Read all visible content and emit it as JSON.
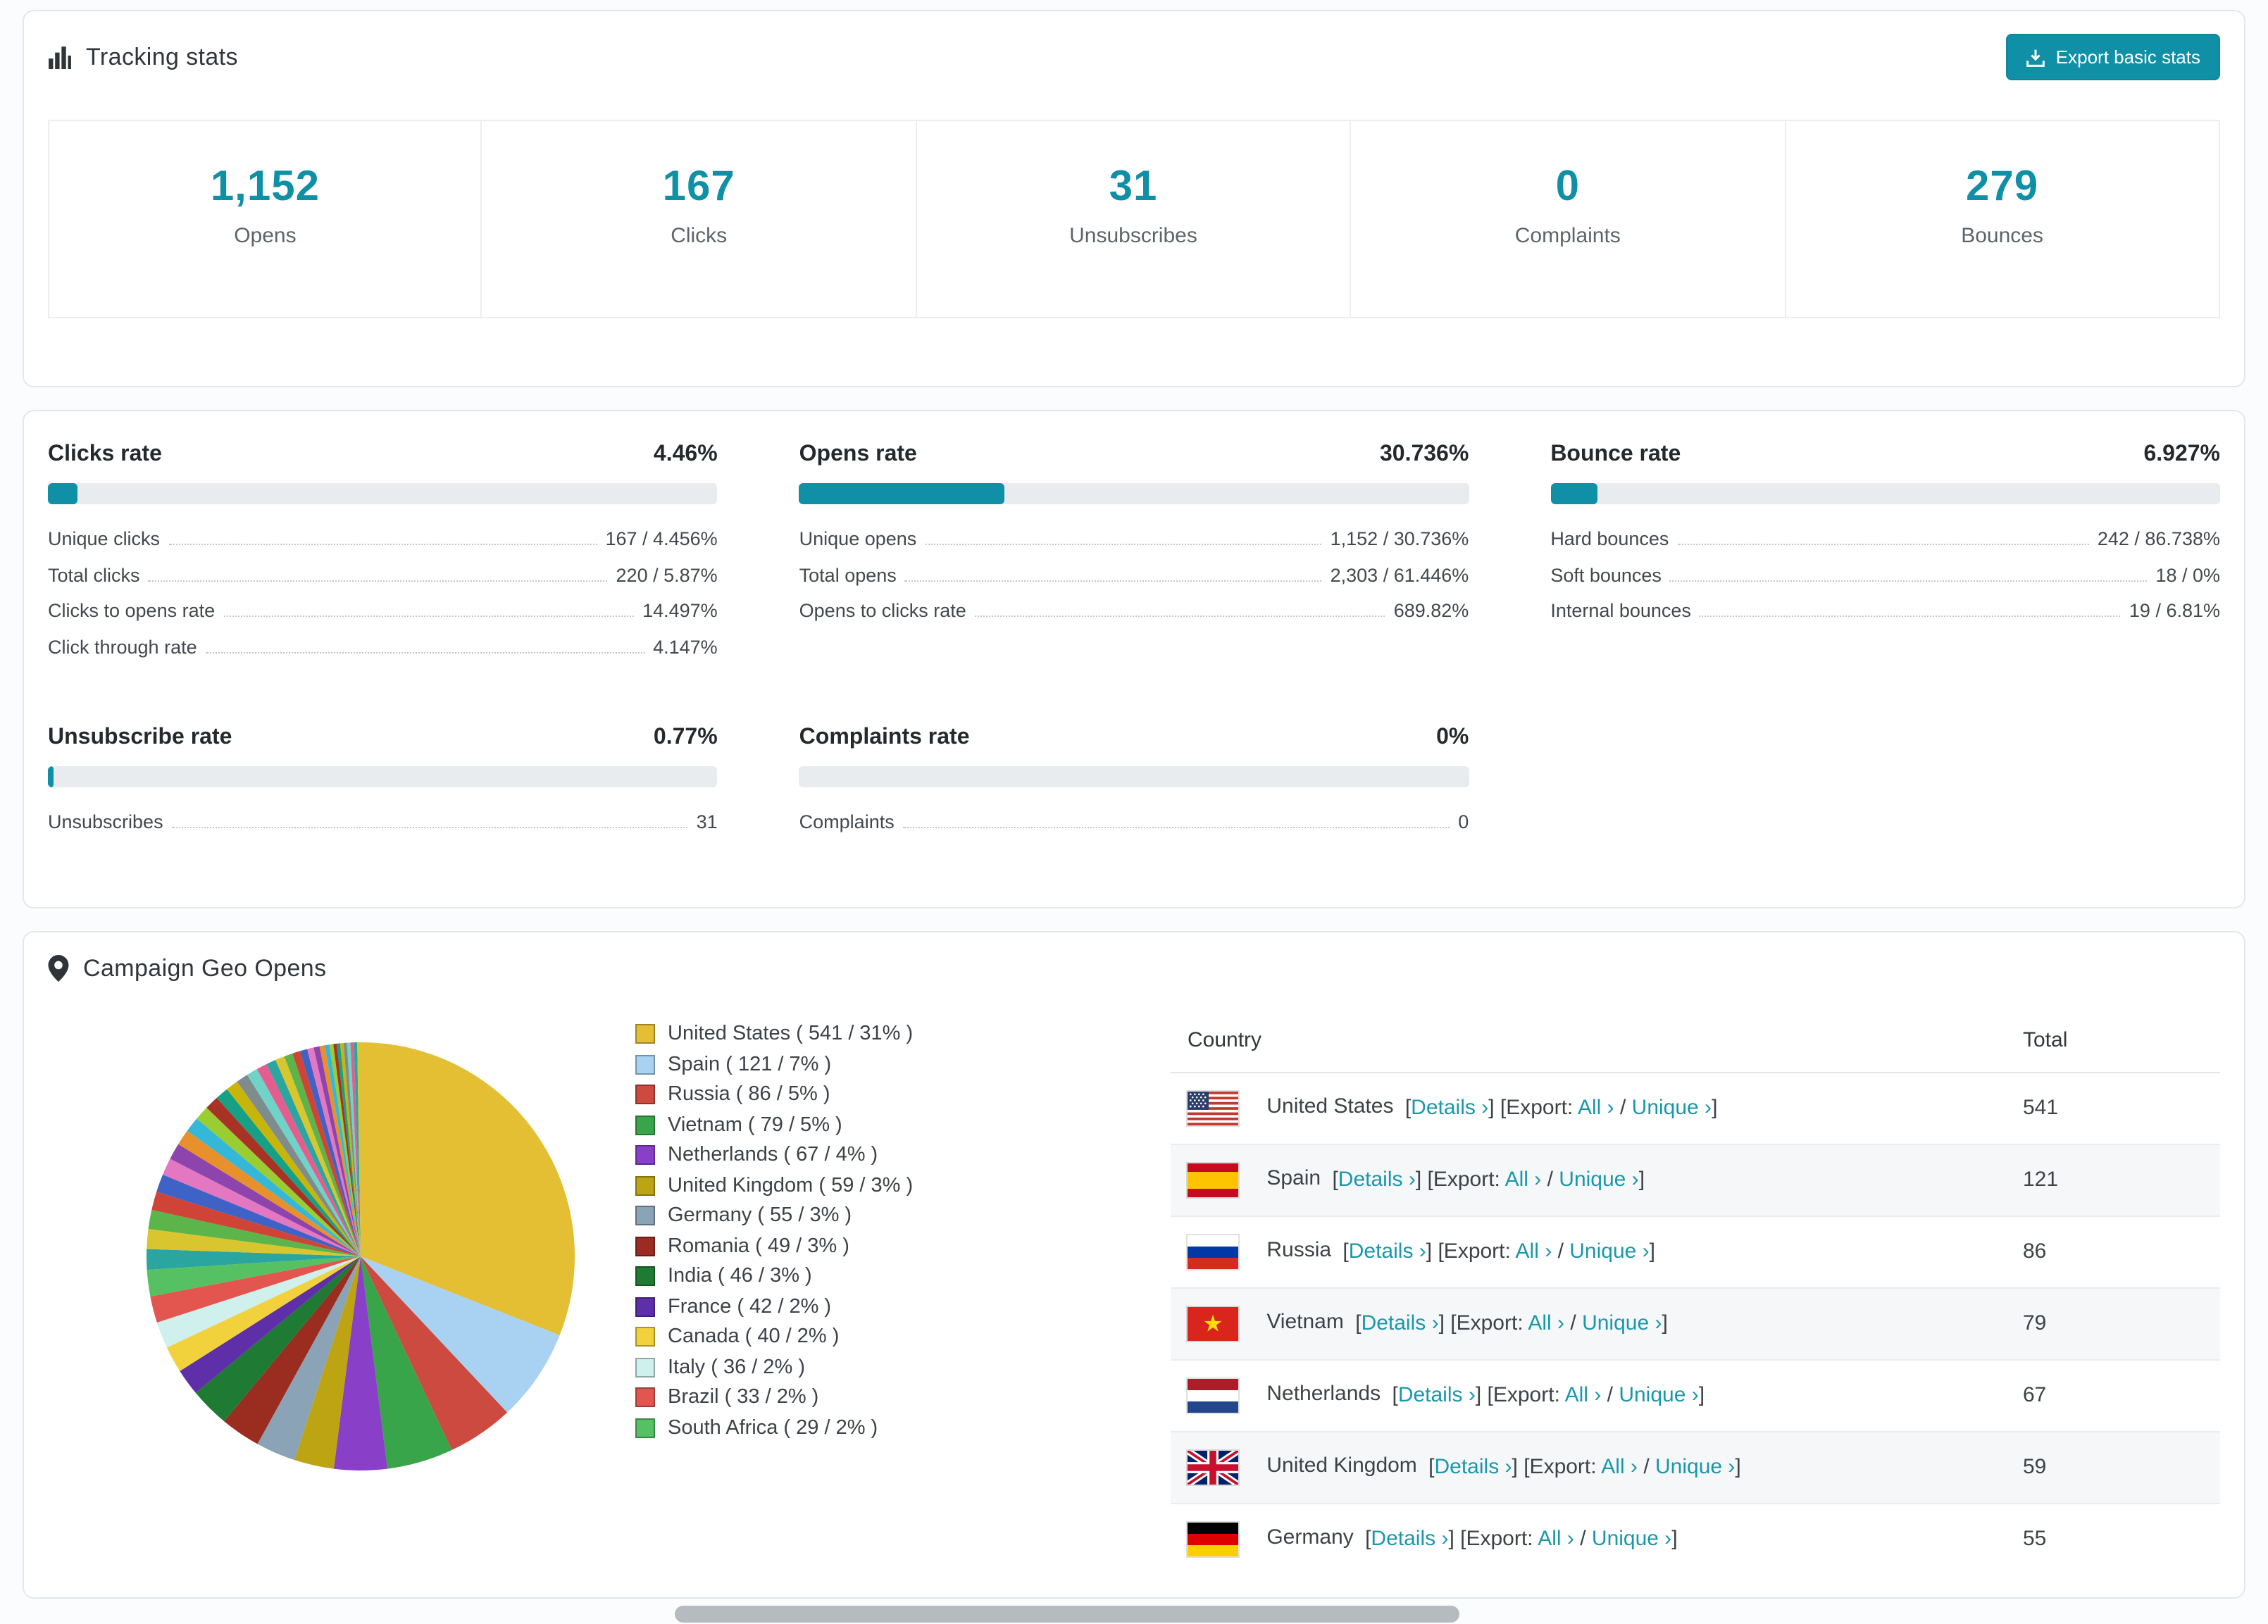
{
  "theme": {
    "accent": "#1090a6",
    "text": "#3c4248",
    "muted": "#5d646b",
    "card_border": "#e5e8ea",
    "bar_track": "#e9ecee",
    "row_stripe": "#f6f7f8"
  },
  "tracking": {
    "title": "Tracking stats",
    "export_label": "Export basic stats",
    "stats": [
      {
        "value": "1,152",
        "label": "Opens"
      },
      {
        "value": "167",
        "label": "Clicks"
      },
      {
        "value": "31",
        "label": "Unsubscribes"
      },
      {
        "value": "0",
        "label": "Complaints"
      },
      {
        "value": "279",
        "label": "Bounces"
      }
    ]
  },
  "rates": [
    {
      "title": "Clicks rate",
      "value": "4.46%",
      "pct": 4.46,
      "rows": [
        {
          "label": "Unique clicks",
          "value": "167 / 4.456%"
        },
        {
          "label": "Total clicks",
          "value": "220 / 5.87%"
        },
        {
          "label": "Clicks to opens rate",
          "value": "14.497%"
        },
        {
          "label": "Click through rate",
          "value": "4.147%"
        }
      ]
    },
    {
      "title": "Opens rate",
      "value": "30.736%",
      "pct": 30.736,
      "rows": [
        {
          "label": "Unique opens",
          "value": "1,152 / 30.736%"
        },
        {
          "label": "Total opens",
          "value": "2,303 / 61.446%"
        },
        {
          "label": "Opens to clicks rate",
          "value": "689.82%"
        }
      ]
    },
    {
      "title": "Bounce rate",
      "value": "6.927%",
      "pct": 6.927,
      "rows": [
        {
          "label": "Hard bounces",
          "value": "242 / 86.738%"
        },
        {
          "label": "Soft bounces",
          "value": "18 / 0%"
        },
        {
          "label": "Internal bounces",
          "value": "19 / 6.81%"
        }
      ]
    },
    {
      "title": "Unsubscribe rate",
      "value": "0.77%",
      "pct": 0.77,
      "rows": [
        {
          "label": "Unsubscribes",
          "value": "31"
        }
      ]
    },
    {
      "title": "Complaints rate",
      "value": "0%",
      "pct": 0,
      "rows": [
        {
          "label": "Complaints",
          "value": "0"
        }
      ]
    }
  ],
  "geo": {
    "title": "Campaign Geo Opens",
    "table": {
      "country_header": "Country",
      "total_header": "Total",
      "links": {
        "open": "[",
        "close": "]",
        "details": "Details ›",
        "export_prefix": "[Export:",
        "all": "All ›",
        "separator": "/",
        "unique": "Unique ›"
      },
      "rows": [
        {
          "flag": "us",
          "country": "United States",
          "total": "541"
        },
        {
          "flag": "es",
          "country": "Spain",
          "total": "121"
        },
        {
          "flag": "ru",
          "country": "Russia",
          "total": "86"
        },
        {
          "flag": "vn",
          "country": "Vietnam",
          "total": "79"
        },
        {
          "flag": "nl",
          "country": "Netherlands",
          "total": "67"
        },
        {
          "flag": "gb",
          "country": "United Kingdom",
          "total": "59"
        },
        {
          "flag": "de",
          "country": "Germany",
          "total": "55"
        }
      ]
    }
  },
  "chart_data": {
    "type": "pie",
    "title": "Campaign Geo Opens",
    "legend_position": "right",
    "unit": "opens",
    "slices": [
      {
        "label": "United States",
        "count": 541,
        "pct": 31,
        "color": "#e4bf33"
      },
      {
        "label": "Spain",
        "count": 121,
        "pct": 7,
        "color": "#a9d2f2"
      },
      {
        "label": "Russia",
        "count": 86,
        "pct": 5,
        "color": "#cc4a3f"
      },
      {
        "label": "Vietnam",
        "count": 79,
        "pct": 5,
        "color": "#38a54a"
      },
      {
        "label": "Netherlands",
        "count": 67,
        "pct": 4,
        "color": "#8a3fc9"
      },
      {
        "label": "United Kingdom",
        "count": 59,
        "pct": 3,
        "color": "#bda412"
      },
      {
        "label": "Germany",
        "count": 55,
        "pct": 3,
        "color": "#8ba3b6"
      },
      {
        "label": "Romania",
        "count": 49,
        "pct": 3,
        "color": "#9a2c20"
      },
      {
        "label": "India",
        "count": 46,
        "pct": 3,
        "color": "#1f7a33"
      },
      {
        "label": "France",
        "count": 42,
        "pct": 2,
        "color": "#5e2fa8"
      },
      {
        "label": "Canada",
        "count": 40,
        "pct": 2,
        "color": "#f2d23c"
      },
      {
        "label": "Italy",
        "count": 36,
        "pct": 2,
        "color": "#cff0ec"
      },
      {
        "label": "Brazil",
        "count": 33,
        "pct": 2,
        "color": "#e2564f"
      },
      {
        "label": "South Africa",
        "count": 29,
        "pct": 2,
        "color": "#55c162"
      }
    ],
    "others_pct": 26
  }
}
